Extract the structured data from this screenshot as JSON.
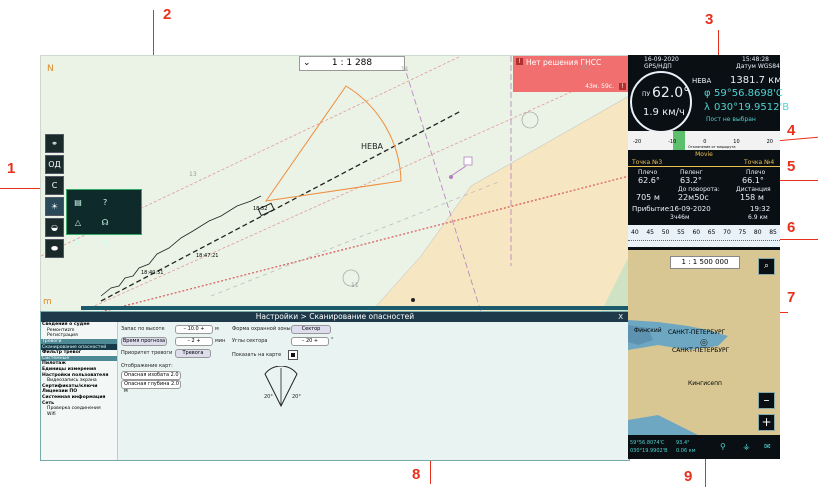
{
  "callouts": [
    "1",
    "2",
    "3",
    "4",
    "5",
    "6",
    "7",
    "8",
    "9"
  ],
  "chart": {
    "scale": "1 : 1 288",
    "scale_chevron": "⌄",
    "north": "N",
    "gnss_alarm": "Нет решения ГНСС",
    "gnss_sub": "43м. 59с.",
    "place_label": "НЕВА",
    "depth_labels": [
      "13",
      "11",
      "11",
      "11"
    ],
    "left_tools": [
      "OД",
      "C"
    ],
    "popup_items": [
      "▤",
      "?",
      "△",
      "☊",
      "⇅",
      "⊘"
    ],
    "track_labels": [
      "18:52",
      "18:47:21",
      "18:40:51"
    ],
    "bottom_marker": "m"
  },
  "settings": {
    "title": "Настройки > Сканирование опасностей",
    "close": "X",
    "menu": [
      {
        "t": "Сведения о судне",
        "cls": "b"
      },
      {
        "t": "Ремонтиzm",
        "cls": "i"
      },
      {
        "t": "Регистрация",
        "cls": "i"
      },
      {
        "t": "Тревоги",
        "cls": "grp"
      },
      {
        "t": "Сканирование опасностей",
        "cls": "sel"
      },
      {
        "t": "Фильтр тревог",
        "cls": "b"
      },
      {
        "t": "Системные",
        "cls": "grp"
      },
      {
        "t": "Пилотаж",
        "cls": "b"
      },
      {
        "t": "Единицы измерения",
        "cls": "b"
      },
      {
        "t": "Настройки пользователя",
        "cls": "b"
      },
      {
        "t": "Видеозапись экрана",
        "cls": "i"
      },
      {
        "t": "Сертификаты/ключи",
        "cls": "b"
      },
      {
        "t": "Лицензии ПО",
        "cls": "b"
      },
      {
        "t": "Системная информация",
        "cls": "b"
      },
      {
        "t": "Сеть",
        "cls": "b"
      },
      {
        "t": "Проверка соединения",
        "cls": "i"
      },
      {
        "t": "Wifi",
        "cls": "i"
      }
    ],
    "f_height": "Запас по высоте",
    "v_height": "– 10.0 +",
    "u_height": "м",
    "f_time": "Время прогноза",
    "v_time": "– 2 +",
    "u_time": "мин",
    "f_alarm": "Приоритет тревоги",
    "v_alarm": "Тревога",
    "f_display": "Отображение карт:",
    "isobath": "Опасная изобата 2.0 м",
    "depth": "Опасная глубина 2.0 м",
    "f_zone": "Форма охранной зоны",
    "v_zone": "Сектор",
    "f_angle": "Углы сектора",
    "v_angle": "– 20 +",
    "u_angle": "°",
    "f_show": "Показать на карте",
    "a1": "20°",
    "a2": "20°"
  },
  "panel": {
    "date": "16-09-2020",
    "time": "15:48:28",
    "gps": "GPS/НДП",
    "datum": "Датум WGS84",
    "ring": "ПУ",
    "course": "62.0°",
    "speed": "1.9 км/ч",
    "place": "НЕВА",
    "dist": "1381.7 км",
    "phi_sym": "φ",
    "lat": "59°56.8698'С",
    "lambda_sym": "λ",
    "lon": "030°19.9512'В",
    "port": "Пост не выбран",
    "scale_ticks": [
      "-20",
      "-10",
      "0",
      "10",
      "20"
    ],
    "scale_caption": "Отклонение от маршрута",
    "mode": "Movie",
    "wp_left": "Точка №3",
    "wp_right": "Точка №4",
    "plecho": "Плечо",
    "pleng": "62.6°",
    "peleng_h": "Пеленг",
    "peleng": "63.2°",
    "plecho2": "Плечо",
    "plecho2_v": "66.1°",
    "to_turn_h": "До поворота:",
    "dist_left": "705 м",
    "to_turn": "22м50с",
    "dist_h": "Дистанция",
    "dist_v": "158 м",
    "arrival_h": "Прибытие:",
    "arrival_date": "16-09-2020",
    "arrival_time": "19:32",
    "arrival_dur": "3ч46м",
    "arrival_km": "6.9 км",
    "ticks": [
      "40",
      "45",
      "50",
      "55",
      "60",
      "65",
      "70",
      "75",
      "80",
      "85"
    ],
    "map_scale": "1 : 1 500 000",
    "cities": [
      "Финский",
      "САНКТ-ПЕТЕРБУРГ",
      "САНКТ-ПЕТЕРБУРГ",
      "Кингисепп"
    ],
    "minus": "–",
    "plus": "+",
    "status_lat": "59°56.8074'С",
    "status_hdg": "93.4°",
    "status_lon": "030°19.9902'В",
    "status_spd": "0.06 км"
  },
  "colors": {
    "alarm": "#f26f6f",
    "cyan": "#4fd1d1",
    "callout": "#e8301c"
  }
}
